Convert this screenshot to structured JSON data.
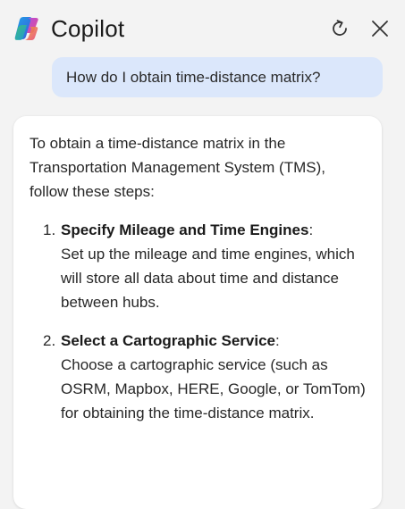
{
  "header": {
    "title": "Copilot",
    "logo_icon": "copilot-logo-icon",
    "refresh_icon": "refresh-icon",
    "close_icon": "close-icon"
  },
  "user_message": {
    "text": "How do I obtain time-distance matrix?"
  },
  "answer": {
    "intro": "To obtain a time-distance matrix in the Transportation Management System (TMS), follow these steps:",
    "steps": [
      {
        "number": "1.",
        "title": "Specify Mileage and Time Engines",
        "colon": ":",
        "body": "Set up the mileage and time engines, which will store all data about time and distance between hubs."
      },
      {
        "number": "2.",
        "title": "Select a Cartographic Service",
        "colon": ":",
        "body": "Choose a cartographic service (such as OSRM, Mapbox, HERE, Google, or TomTom) for obtaining the time-distance matrix."
      }
    ]
  },
  "colors": {
    "background": "#f3f3f3",
    "user_bubble": "#dbe7fb",
    "card": "#ffffff"
  }
}
